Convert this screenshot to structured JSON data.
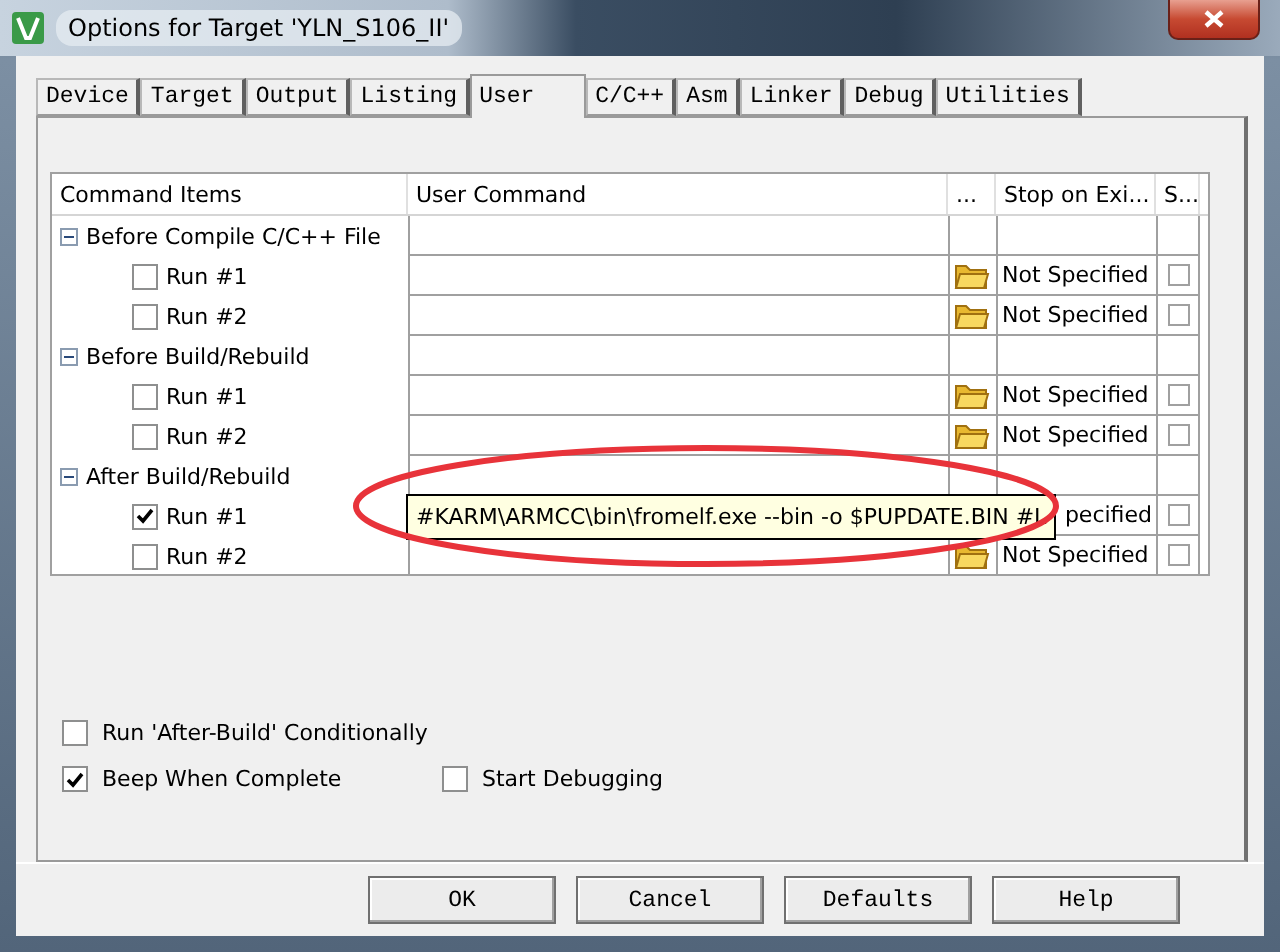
{
  "window": {
    "title": "Options for Target 'YLN_S106_II'"
  },
  "tabs": [
    {
      "label": "Device",
      "selected": false
    },
    {
      "label": "Target",
      "selected": false
    },
    {
      "label": "Output",
      "selected": false
    },
    {
      "label": "Listing",
      "selected": false
    },
    {
      "label": "User",
      "selected": true
    },
    {
      "label": "C/C++",
      "selected": false
    },
    {
      "label": "Asm",
      "selected": false
    },
    {
      "label": "Linker",
      "selected": false
    },
    {
      "label": "Debug",
      "selected": false
    },
    {
      "label": "Utilities",
      "selected": false
    }
  ],
  "table": {
    "columns": [
      "Command Items",
      "User Command",
      "...",
      "Stop on Exi...",
      "S..."
    ],
    "groups": [
      {
        "label": "Before Compile C/C++ File",
        "expanded": true,
        "children": [
          {
            "label": "Run #1",
            "checked": false,
            "stop_on_exit": "Not Specified",
            "stop_checked": false
          },
          {
            "label": "Run #2",
            "checked": false,
            "stop_on_exit": "Not Specified",
            "stop_checked": false
          }
        ]
      },
      {
        "label": "Before Build/Rebuild",
        "expanded": true,
        "children": [
          {
            "label": "Run #1",
            "checked": false,
            "stop_on_exit": "Not Specified",
            "stop_checked": false
          },
          {
            "label": "Run #2",
            "checked": false,
            "stop_on_exit": "Not Specified",
            "stop_checked": false
          }
        ]
      },
      {
        "label": "After Build/Rebuild",
        "expanded": true,
        "children": [
          {
            "label": "Run #1",
            "checked": true,
            "stop_on_exit": "pecified",
            "stop_checked": false
          },
          {
            "label": "Run #2",
            "checked": false,
            "stop_on_exit": "Not Specified",
            "stop_checked": false
          }
        ]
      }
    ]
  },
  "tooltip": {
    "text": "#KARM\\ARMCC\\bin\\fromelf.exe --bin -o $PUPDATE.BIN #L"
  },
  "options": [
    [
      {
        "label": "Run 'After-Build' Conditionally",
        "checked": false
      }
    ],
    [
      {
        "label": "Beep When Complete",
        "checked": true
      },
      {
        "label": "Start Debugging",
        "checked": false
      }
    ]
  ],
  "buttons": [
    "OK",
    "Cancel",
    "Defaults",
    "Help"
  ]
}
